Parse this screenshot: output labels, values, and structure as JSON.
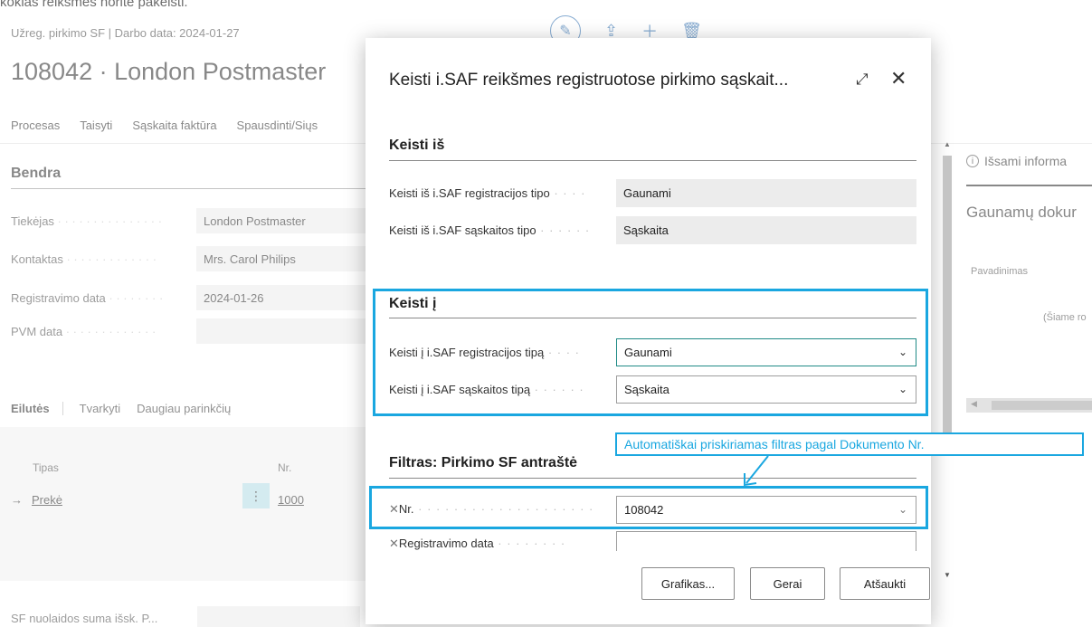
{
  "top_note": "kokias reikšmes norite pakeisti.",
  "background": {
    "breadcrumb": "Užreg. pirkimo SF | Darbo data: 2024-01-27",
    "title": "108042 · London Postmaster",
    "menu": [
      "Procesas",
      "Taisyti",
      "Sąskaita faktūra",
      "Spausdinti/Siųs"
    ],
    "section": "Bendra",
    "fields": [
      {
        "label": "Tiekėjas",
        "value": "London Postmaster"
      },
      {
        "label": "Kontaktas",
        "value": "Mrs. Carol Philips"
      },
      {
        "label": "Registravimo data",
        "value": "2024-01-26"
      },
      {
        "label": "PVM data",
        "value": ""
      }
    ],
    "lines_tabs": [
      "Eilutės",
      "Tvarkyti",
      "Daugiau parinkčių"
    ],
    "lines_columns": {
      "type": "Tipas",
      "no": "Nr."
    },
    "line": {
      "type": "Prekė",
      "no": "1000"
    },
    "bottom_label": "SF nuolaidos suma išsk. P..."
  },
  "factbox": {
    "info_tab": "Išsami informa",
    "heading": "Gaunamų dokur",
    "column": "Pavadinimas",
    "note": "(Šiame ro"
  },
  "dialog": {
    "title": "Keisti i.SAF reikšmes registruotose pirkimo sąskait...",
    "sections": {
      "from": {
        "title": "Keisti iš",
        "reg_type_label": "Keisti iš i.SAF registracijos tipo",
        "reg_type_value": "Gaunami",
        "inv_type_label": "Keisti iš i.SAF sąskaitos tipo",
        "inv_type_value": "Sąskaita"
      },
      "to": {
        "title": "Keisti į",
        "reg_type_label": "Keisti į i.SAF registracijos tipą",
        "reg_type_value": "Gaunami",
        "inv_type_label": "Keisti į i.SAF sąskaitos tipą",
        "inv_type_value": "Sąskaita"
      },
      "filter": {
        "title": "Filtras: Pirkimo SF antraštė",
        "no_label": "Nr.",
        "no_value": "108042",
        "date_label": "Registravimo data",
        "date_value": ""
      }
    },
    "buttons": {
      "chart": "Grafikas...",
      "ok": "Gerai",
      "cancel": "Atšaukti"
    }
  },
  "annotation": "Automatiškai priskiriamas filtras pagal Dokumento Nr.",
  "colors": {
    "highlight": "#1aa7e0",
    "accent": "#1f8a86",
    "action_icon": "#2f6fb0"
  },
  "icons": {
    "edit": "pencil-icon",
    "share": "share-icon",
    "add": "plus-icon",
    "delete": "trash-icon",
    "expand": "expand-icon",
    "close": "close-icon",
    "remove_filter": "x-icon",
    "dropdown": "chevron-down-icon",
    "info": "info-icon"
  }
}
